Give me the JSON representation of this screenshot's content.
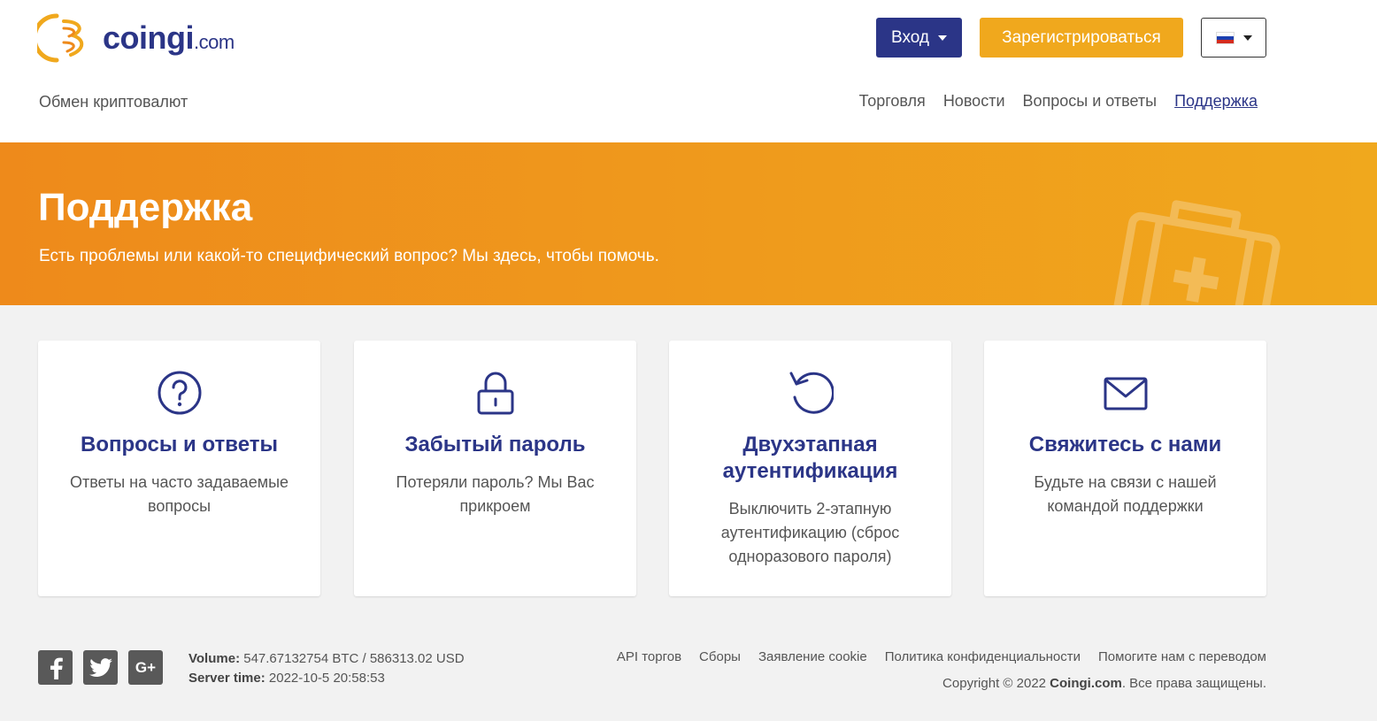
{
  "brand": {
    "name": "coingi",
    "domain": ".com",
    "tagline": "Обмен криптовалют",
    "primary": "#2b3587",
    "accent": "#f0a81d"
  },
  "header": {
    "login_label": "Вход",
    "register_label": "Зарегистрироваться",
    "lang_icon": "russian-flag-icon"
  },
  "nav": {
    "items": [
      "Торговля",
      "Новости",
      "Вопросы и ответы",
      "Поддержка"
    ],
    "active": "Поддержка"
  },
  "hero": {
    "title": "Поддержка",
    "subtitle": "Есть проблемы или какой-то специфический вопрос? Мы здесь, чтобы помочь."
  },
  "cards": [
    {
      "icon": "question-circle-icon",
      "title": "Вопросы и ответы",
      "desc": "Ответы на часто задаваемые вопросы"
    },
    {
      "icon": "lock-icon",
      "title": "Забытый пароль",
      "desc": "Потеряли пароль? Мы Вас прикроем"
    },
    {
      "icon": "reset-icon",
      "title": "Двухэтапная аутентификация",
      "desc": "Выключить 2-этапную аутентификацию (сброс одноразового пароля)"
    },
    {
      "icon": "envelope-icon",
      "title": "Свяжитесь с нами",
      "desc": "Будьте на связи с нашей командой поддержки"
    }
  ],
  "footer": {
    "volume_label": "Volume:",
    "volume_value": "547.67132754 BTC / 586313.02 USD",
    "server_time_label": "Server time:",
    "server_time_value": "2022-10-5 20:58:53",
    "links": [
      "API торгов",
      "Сборы",
      "Заявление cookie",
      "Политика конфиденциальности",
      "Помогите нам с переводом"
    ],
    "copyright_prefix": "Copyright © 2022 ",
    "copyright_brand": "Coingi.com",
    "copyright_suffix": ". Все права защищены.",
    "social": [
      "facebook-icon",
      "twitter-icon",
      "google-plus-icon"
    ]
  }
}
